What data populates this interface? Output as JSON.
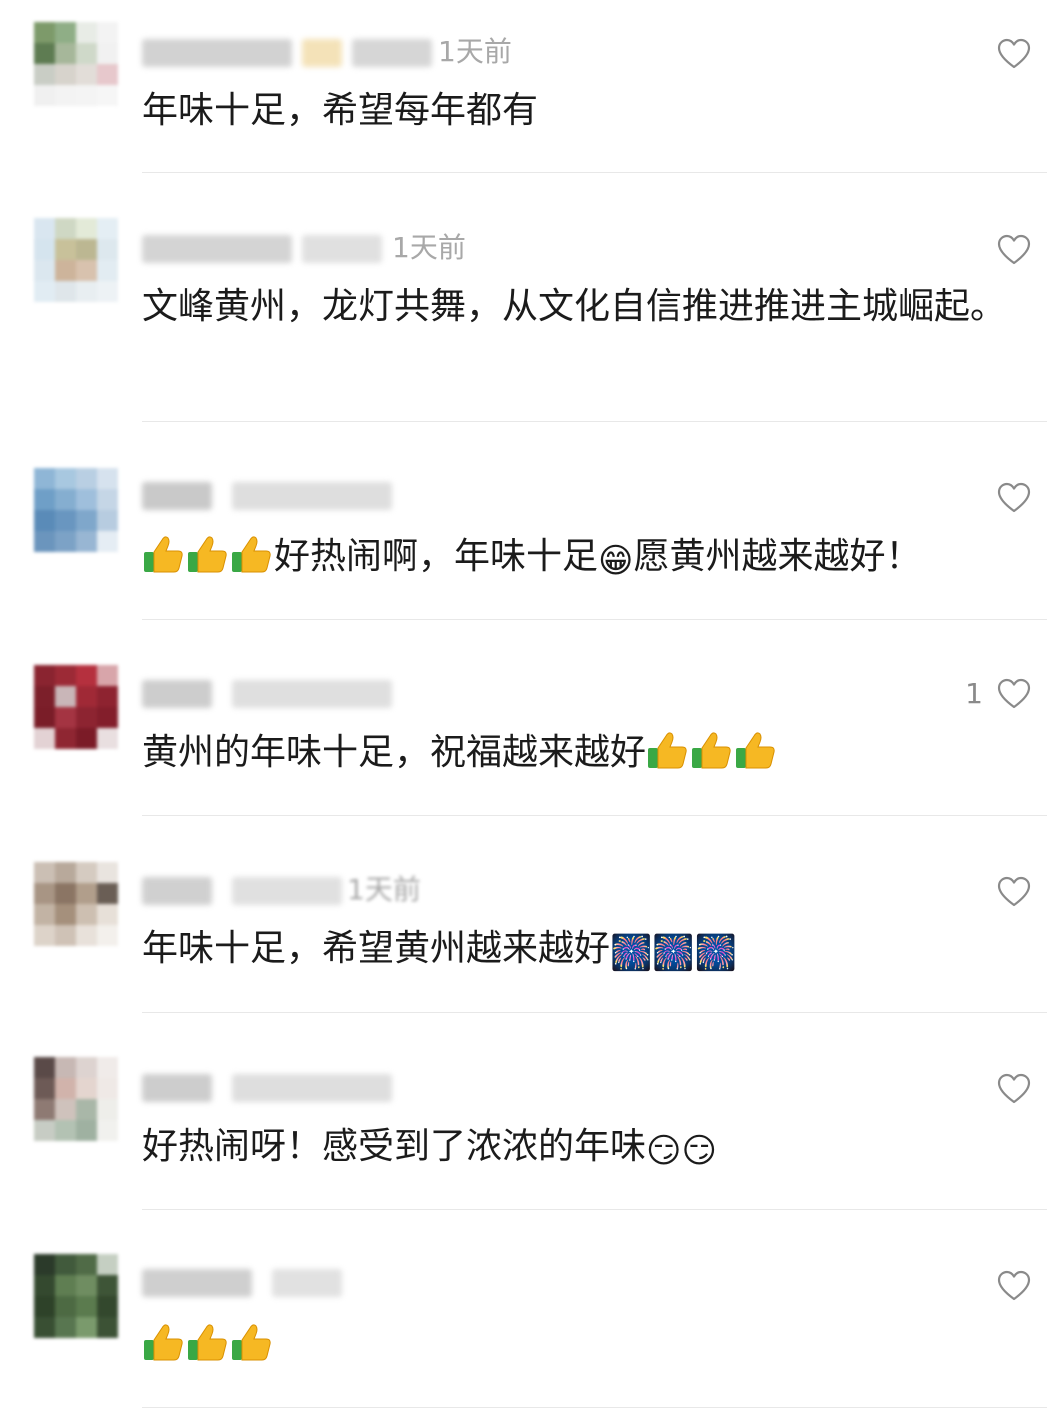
{
  "comments": [
    {
      "time": "1天前",
      "text": "年味十足，希望每年都有",
      "likes": ""
    },
    {
      "time": "1天前",
      "text": "文峰黄州，龙灯共舞，从文化自信推进推进主城崛起。",
      "likes": ""
    },
    {
      "time": "",
      "text_prefix": "",
      "text_mid": "好热闹啊，年味十足",
      "text_end": "愿黄州越来越好！",
      "likes": ""
    },
    {
      "time": "",
      "text": "黄州的年味十足，祝福越来越好",
      "likes": "1"
    },
    {
      "time": "1天前",
      "text": "年味十足，希望黄州越来越好",
      "likes": ""
    },
    {
      "time": "",
      "text": "好热闹呀！感受到了浓浓的年味",
      "likes": ""
    },
    {
      "time": "",
      "text": "",
      "likes": ""
    }
  ],
  "icons": {
    "like": "heart-outline-icon",
    "thumb": "thumbs-up-emoji",
    "grin": "grinning-emoji",
    "firework": "fireworks-emoji",
    "smirk666": "smirk-666-emoji"
  },
  "colors": {
    "text": "#1b1b1b",
    "meta": "#a8a8a8",
    "divider": "#e8e8e8",
    "heart": "#8a8a8a"
  }
}
